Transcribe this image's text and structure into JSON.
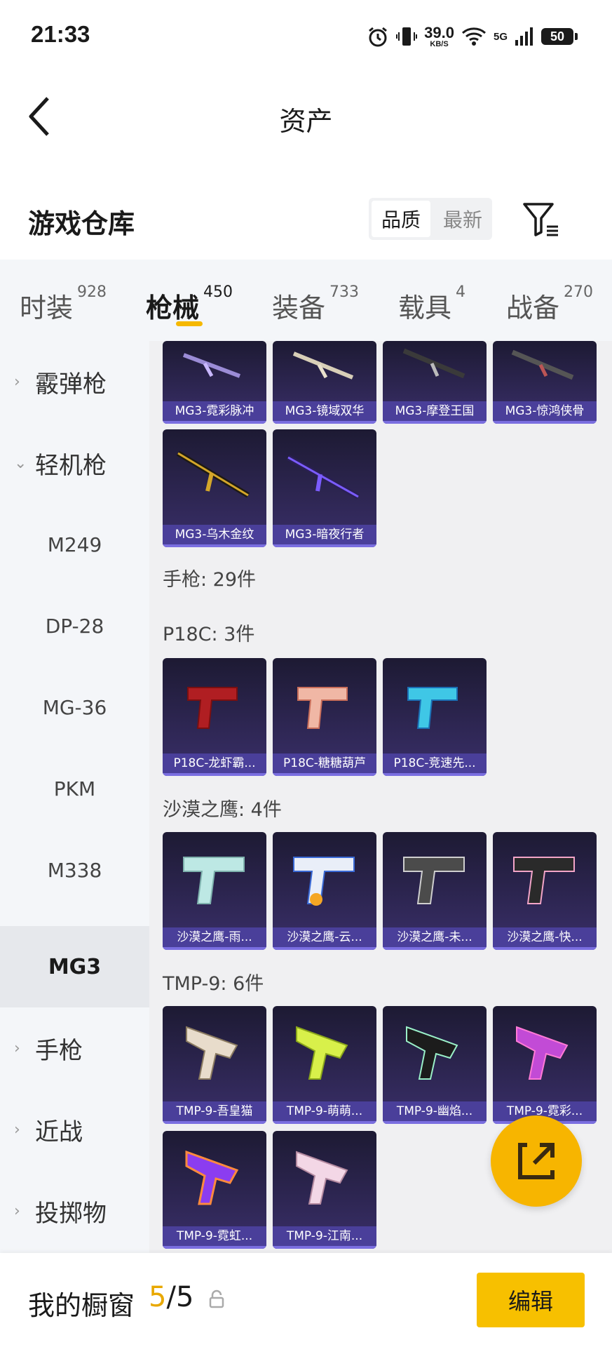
{
  "status_bar": {
    "time": "21:33",
    "net_speed": "39.0",
    "net_unit": "KB/S",
    "signal_label": "5G",
    "battery": "50"
  },
  "header": {
    "title": "资产"
  },
  "section": {
    "title": "游戏仓库",
    "sort_options": [
      "品质",
      "最新"
    ],
    "sort_active": "品质"
  },
  "tabs": [
    {
      "label": "时装",
      "count": "928"
    },
    {
      "label": "枪械",
      "count": "450"
    },
    {
      "label": "装备",
      "count": "733"
    },
    {
      "label": "载具",
      "count": "4"
    },
    {
      "label": "战备",
      "count": "270"
    }
  ],
  "sidebar": [
    {
      "label": "霰弹枪"
    },
    {
      "label": "轻机枪"
    },
    {
      "label": "M249"
    },
    {
      "label": "DP-28"
    },
    {
      "label": "MG-36"
    },
    {
      "label": "PKM"
    },
    {
      "label": "M338"
    },
    {
      "label": "MG3"
    },
    {
      "label": "手枪"
    },
    {
      "label": "近战"
    },
    {
      "label": "投掷物"
    }
  ],
  "content": {
    "mg3_row1": [
      "MG3-霓彩脉冲",
      "MG3-镜域双华",
      "MG3-摩登王国",
      "MG3-惊鸿侠骨"
    ],
    "mg3_row2": [
      "MG3-乌木金纹",
      "MG3-暗夜行者"
    ],
    "pistol_label": "手枪: 29件",
    "p18c_label": "P18C: 3件",
    "p18c": [
      "P18C-龙虾霸...",
      "P18C-糖糖葫芦",
      "P18C-竞速先..."
    ],
    "deagle_label": "沙漠之鹰: 4件",
    "deagle": [
      "沙漠之鹰-雨...",
      "沙漠之鹰-云...",
      "沙漠之鹰-未...",
      "沙漠之鹰-快..."
    ],
    "tmp_label": "TMP-9: 6件",
    "tmp_row1": [
      "TMP-9-吾皇猫",
      "TMP-9-萌萌...",
      "TMP-9-幽焰...",
      "TMP-9-霓彩..."
    ],
    "tmp_row2": [
      "TMP-9-霓虹...",
      "TMP-9-江南..."
    ]
  },
  "bottom": {
    "label": "我的橱窗",
    "count_current": "5",
    "count_sep": "/",
    "count_total": "5",
    "edit": "编辑"
  },
  "colors": {
    "accent": "#f7b500",
    "card_bg": "#2a2450",
    "card_caption": "#4a3f9a"
  }
}
